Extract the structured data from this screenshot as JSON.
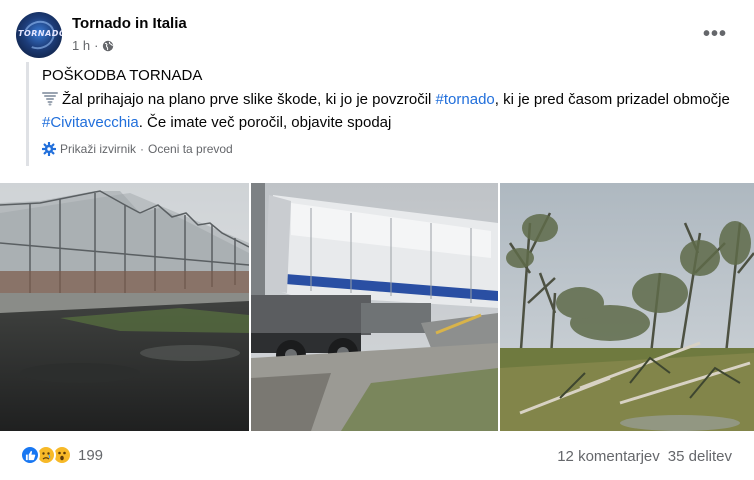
{
  "post": {
    "page_name": "Tornado in Italia",
    "avatar_text": "TORNADO",
    "time": "1 h",
    "dot": "·",
    "more_label": "•••",
    "title": "POŠKODBA TORNADA",
    "body_part1": "Žal prihajajo na plano prve slike škode, ki jo je povzročil ",
    "hashtag1": "#tornado",
    "body_part2": ", ki je pred časom prizadel območje ",
    "hashtag2": "#Civitavecchia",
    "body_part3": ". Če imate več poročil, objavite spodaj",
    "show_original": "Prikaži izvirnik",
    "rate_translation": "Oceni ta prevod",
    "separator": "·"
  },
  "photos": [
    {
      "name": "photo-damaged-greenhouses"
    },
    {
      "name": "photo-damaged-truck-trailer"
    },
    {
      "name": "photo-fallen-trees"
    }
  ],
  "footer": {
    "reaction_count": "199",
    "comments": "12 komentarjev",
    "shares": "35 delitev"
  },
  "colors": {
    "link": "#216fdb",
    "muted": "#65676b",
    "like_blue": "#1877f2",
    "reaction_yellow": "#f7b928"
  },
  "icons": {
    "globe": "globe-icon",
    "gear": "gear-icon",
    "tornado": "tornado-emoji-icon",
    "like": "like-icon",
    "sad": "sad-icon",
    "wow": "wow-icon"
  }
}
